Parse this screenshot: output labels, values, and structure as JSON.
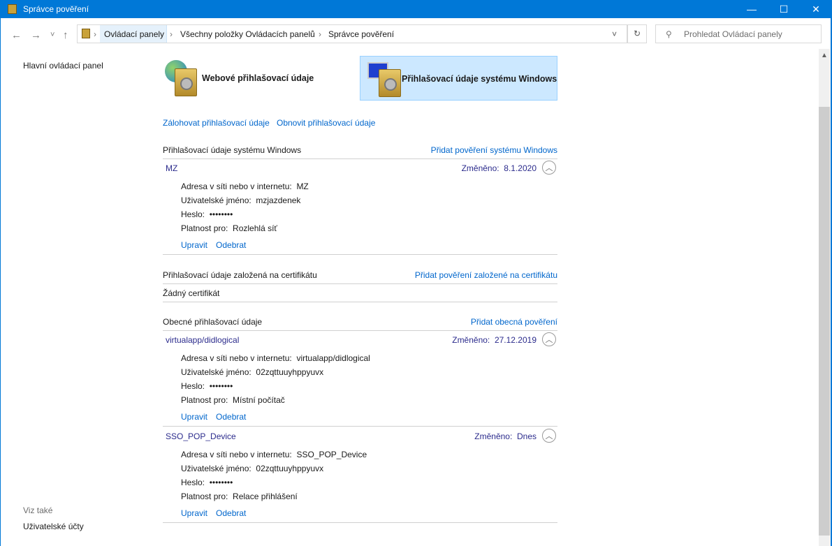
{
  "window": {
    "title": "Správce pověření",
    "minimize": "—",
    "maximize": "☐",
    "close": "✕"
  },
  "nav": {
    "back": "←",
    "forward": "→",
    "recent": "˅",
    "up": "↑",
    "refresh": "↻",
    "dropdown": "˅"
  },
  "breadcrumb": [
    "Ovládací panely",
    "Všechny položky Ovládacích panelů",
    "Správce pověření"
  ],
  "search": {
    "placeholder": "Prohledat Ovládací panely",
    "icon": "search-icon"
  },
  "sidebar": {
    "home": "Hlavní ovládací panel",
    "see_also": "Viz také",
    "user_accounts": "Uživatelské účty"
  },
  "tiles": {
    "web": "Webové přihlašovací údaje",
    "windows": "Přihlašovací údaje systému Windows"
  },
  "actions": {
    "backup": "Zálohovat přihlašovací údaje",
    "restore": "Obnovit přihlašovací údaje"
  },
  "labels": {
    "address": "Adresa v síti nebo v internetu:",
    "user": "Uživatelské jméno:",
    "password": "Heslo:",
    "persistence": "Platnost pro:",
    "modified": "Změněno:",
    "edit": "Upravit",
    "remove": "Odebrat"
  },
  "sections": {
    "windows": {
      "title": "Přihlašovací údaje systému Windows",
      "add": "Přidat pověření systému Windows"
    },
    "certificate": {
      "title": "Přihlašovací údaje založená na certifikátu",
      "add": "Přidat pověření založené na certifikátu",
      "empty": "Žádný certifikát"
    },
    "generic": {
      "title": "Obecné přihlašovací údaje",
      "add": "Přidat obecná pověření"
    }
  },
  "credentials": [
    {
      "name": "MZ",
      "modified": "8.1.2020",
      "address": "MZ",
      "user": "mzjazdenek",
      "password": "••••••••",
      "persistence": "Rozlehlá síť"
    },
    {
      "name": "virtualapp/didlogical",
      "modified": "27.12.2019",
      "address": "virtualapp/didlogical",
      "user": "02zqttuuyhppyuvx",
      "password": "••••••••",
      "persistence": "Místní počítač"
    },
    {
      "name": "SSO_POP_Device",
      "modified": "Dnes",
      "address": "SSO_POP_Device",
      "user": "02zqttuuyhppyuvx",
      "password": "••••••••",
      "persistence": "Relace přihlášení"
    }
  ]
}
